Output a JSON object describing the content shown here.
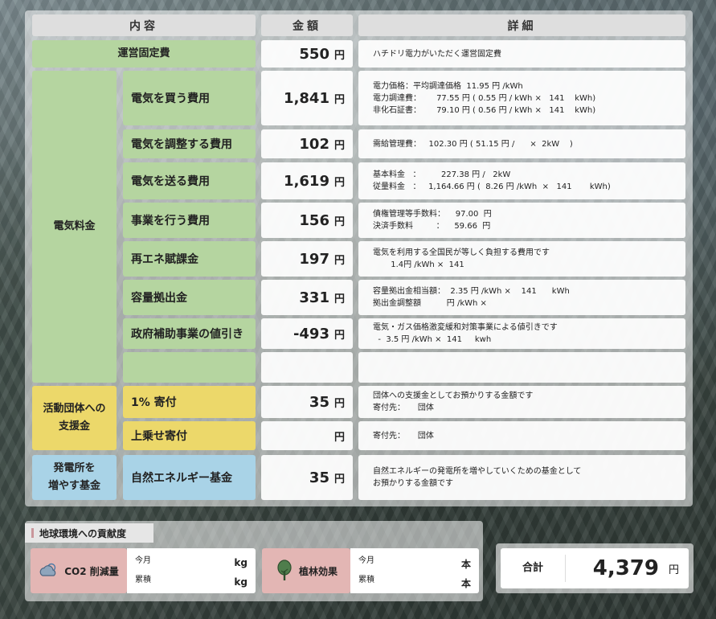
{
  "headers": {
    "content": "内容",
    "amount": "金額",
    "detail": "詳細"
  },
  "unit_yen": "円",
  "rows": {
    "fixed": {
      "label": "運営固定費",
      "amount": "550",
      "detail": [
        "ハチドリ電力がいただく運営固定費"
      ]
    },
    "buy": {
      "label": "電気を買う費用",
      "amount": "1,841",
      "detail": [
        "電力価格：平均調達価格  11.95 円 /kWh",
        "電力調達費：      77.55 円 ( 0.55 円 / kWh ×   141    kWh)",
        "非化石証書：      79.10 円 ( 0.56 円 / kWh ×   141    kWh)"
      ]
    },
    "adjust": {
      "label": "電気を調整する費用",
      "amount": "102",
      "detail": [
        "需給管理費：   102.30 円 ( 51.15 円 /      ×  2kW    )"
      ]
    },
    "send": {
      "label": "電気を送る費用",
      "amount": "1,619",
      "detail": [
        "基本料金   ：        227.38 円 /   2kW",
        "従量料金   ：   1,164.66 円 (  8.26 円 /kWh  ×   141       kWh)"
      ]
    },
    "business": {
      "label": "事業を行う費用",
      "amount": "156",
      "detail": [
        "債権管理等手数料：    97.00  円",
        "決済手数料         ：    59.66  円"
      ]
    },
    "renewable": {
      "label": "再エネ賦課金",
      "amount": "197",
      "detail": [
        "電気を利用する全国民が等しく負担する費用です",
        "       1.4円 /kWh ×  141"
      ]
    },
    "capacity": {
      "label": "容量拠出金",
      "amount": "331",
      "detail": [
        "容量拠出金相当額：  2.35 円 /kWh ×    141      kWh",
        "拠出金調整額          円 /kWh ×"
      ]
    },
    "subsidy": {
      "label": "政府補助事業の値引き",
      "amount": "-493",
      "detail": [
        "電気・ガス価格激変緩和対策事業による値引きです",
        "  -  3.5 円 /kWh ×  141     kwh"
      ]
    },
    "donation1": {
      "label": "1% 寄付",
      "amount": "35",
      "detail": [
        "団体への支援金としてお預かりする金額です",
        "寄付先：     団体"
      ]
    },
    "donation2": {
      "label": "上乗せ寄付",
      "amount": "",
      "detail": [
        "寄付先：     団体"
      ]
    },
    "fund": {
      "label": "自然エネルギー基金",
      "amount": "35",
      "detail": [
        "自然エネルギーの発電所を増やしていくための基金として",
        "お預かりする金額です"
      ]
    }
  },
  "categories": {
    "electricity": "電気料金",
    "support": [
      "活動団体への",
      "支援金"
    ],
    "plants": [
      "発電所を",
      "増やす基金"
    ]
  },
  "contribution": {
    "title": "地球環境への貢献度",
    "co2": {
      "label": "CO2 削減量",
      "icon": "cloud-icon",
      "this_month": "今月",
      "cumulative": "累積",
      "unit": "kg"
    },
    "trees": {
      "label": "植林効果",
      "icon": "tree-icon",
      "this_month": "今月",
      "cumulative": "累積",
      "unit": "本"
    }
  },
  "total": {
    "label": "合計",
    "value": "4,379",
    "unit": "円"
  }
}
